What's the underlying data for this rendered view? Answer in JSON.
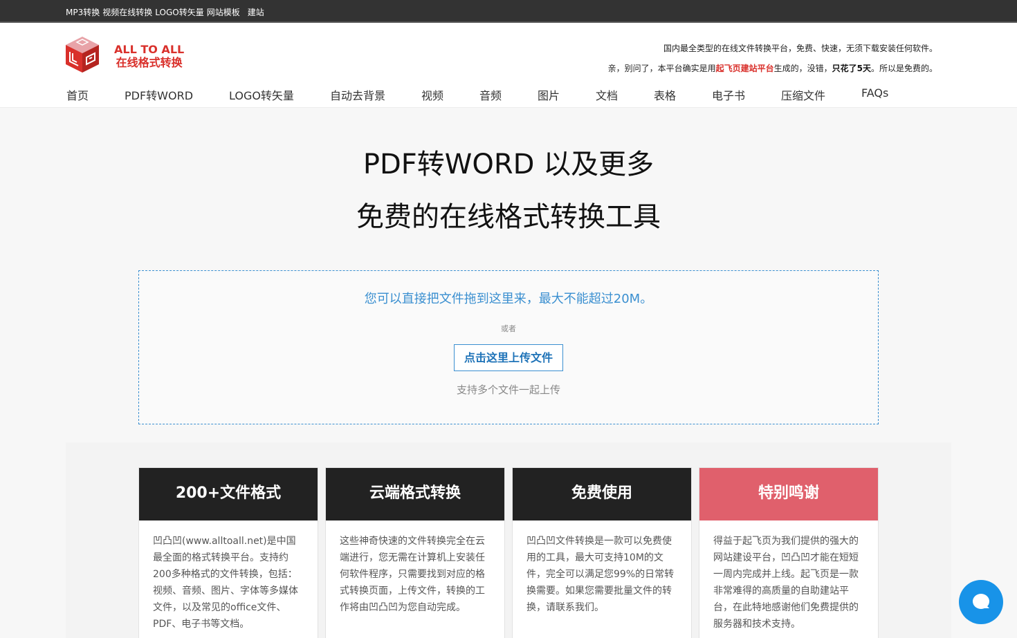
{
  "topbar": {
    "links": [
      "MP3转换",
      "视频在线转换",
      "LOGO转矢量",
      "网站模板"
    ],
    "extra": "建站"
  },
  "logo": {
    "line1": "ALL TO ALL",
    "line2": "在线格式转换",
    "colors": {
      "red": "#d9302b"
    }
  },
  "notice": {
    "line1": "国内最全类型的在线文件转换平台，免费、快速，无须下载安装任何软件。",
    "line2_prefix": "亲，别问了，本平台确实是用",
    "line2_link": "起飞页建站平台",
    "line2_mid": "生成的，没错，",
    "line2_bold": "只花了5天",
    "line2_suffix": "。所以是免费的。"
  },
  "nav": {
    "items": [
      "首页",
      "PDF转WORD",
      "LOGO转矢量",
      "自动去背景",
      "视频",
      "音频",
      "图片",
      "文档",
      "表格",
      "电子书",
      "压缩文件",
      "FAQs"
    ]
  },
  "hero": {
    "title1": "PDF转WORD 以及更多",
    "title2": "免费的在线格式转换工具"
  },
  "dropzone": {
    "main": "您可以直接把文件拖到这里来，最大不能超过20M。",
    "or": "或者",
    "button": "点击这里上传文件",
    "multi": "支持多个文件一起上传"
  },
  "cards": [
    {
      "title": "200+文件格式",
      "body": "凹凸凹(www.alltoall.net)是中国最全面的格式转换平台。支持约200多种格式的文件转换，包括：视频、音频、图片、字体等多媒体文件，以及常见的office文件、PDF、电子书等文档。"
    },
    {
      "title": "云端格式转换",
      "body": "这些神奇快速的文件转换完全在云端进行，您无需在计算机上安装任何软件程序，只需要找到对应的格式转换页面，上传文件，转换的工作将由凹凸凹为您自动完成。"
    },
    {
      "title": "免费使用",
      "body": "凹凸凹文件转换是一款可以免费使用的工具，最大可支持10M的文件，完全可以满足您99%的日常转换需要。如果您需要批量文件的转换，请联系我们。"
    },
    {
      "title": "特别鸣谢",
      "body": "得益于起飞页为我们提供的强大的网站建设平台，凹凸凹才能在短短一周内完成并上线。起飞页是一款非常难得的高质量的自助建站平台，在此特地感谢他们免费提供的服务器和技术支持。"
    }
  ],
  "chat": {
    "icon": "chat-bubble-icon",
    "color": "#1893e8"
  }
}
